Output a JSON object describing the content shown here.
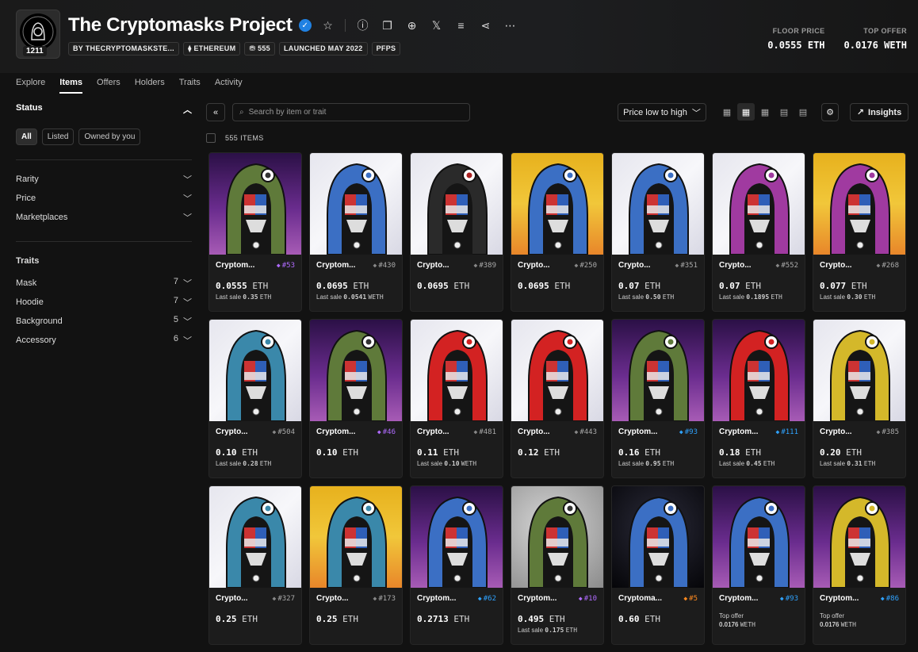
{
  "header": {
    "title": "The Cryptomasks Project",
    "logo_text": "THE CRYPTOMASKS",
    "logo_count": "1211",
    "tags": [
      "BY THECRYPTOMASKSTE...",
      "⧫ ETHEREUM",
      "555",
      "LAUNCHED MAY 2022",
      "PFPS"
    ],
    "stats": [
      {
        "label": "FLOOR PRICE",
        "value": "0.0555 ETH"
      },
      {
        "label": "TOP OFFER",
        "value": "0.0176 WETH"
      }
    ]
  },
  "nav": [
    "Explore",
    "Items",
    "Offers",
    "Holders",
    "Traits",
    "Activity"
  ],
  "sidebar": {
    "status_label": "Status",
    "chips": [
      "All",
      "Listed",
      "Owned by you"
    ],
    "filters": [
      "Rarity",
      "Price",
      "Marketplaces"
    ],
    "traits_label": "Traits",
    "traits": [
      {
        "name": "Mask",
        "count": "7"
      },
      {
        "name": "Hoodie",
        "count": "7"
      },
      {
        "name": "Background",
        "count": "5"
      },
      {
        "name": "Accessory",
        "count": "6"
      }
    ]
  },
  "toolbar": {
    "search_placeholder": "Search by item or trait",
    "sort": "Price low to high",
    "insights": "Insights"
  },
  "items_count": "555 ITEMS",
  "items": [
    {
      "name": "Cryptom...",
      "rank": "#53",
      "gem": "#b06bff",
      "price": "0.0555",
      "unit": "ETH",
      "sub_label": "Last sale",
      "sub_val": "0.35",
      "sub_unit": "ETH",
      "bg": "purple",
      "hood": "#5f7a3a",
      "crest": "#333"
    },
    {
      "name": "Cryptom...",
      "rank": "#430",
      "gem": "#888",
      "price": "0.0695",
      "unit": "ETH",
      "sub_label": "Last sale",
      "sub_val": "0.0541",
      "sub_unit": "WETH",
      "bg": "white",
      "hood": "#3b6fc4",
      "crest": "#3b6fc4"
    },
    {
      "name": "Crypto...",
      "rank": "#389",
      "gem": "#888",
      "price": "0.0695",
      "unit": "ETH",
      "sub_label": "",
      "sub_val": "",
      "sub_unit": "",
      "bg": "white",
      "hood": "#2a2a2a",
      "crest": "#aa2222"
    },
    {
      "name": "Crypto...",
      "rank": "#250",
      "gem": "#888",
      "price": "0.0695",
      "unit": "ETH",
      "sub_label": "",
      "sub_val": "",
      "sub_unit": "",
      "bg": "yellow",
      "hood": "#3b6fc4",
      "crest": "#3b6fc4"
    },
    {
      "name": "Crypto...",
      "rank": "#351",
      "gem": "#888",
      "price": "0.07",
      "unit": "ETH",
      "sub_label": "Last sale",
      "sub_val": "0.50",
      "sub_unit": "ETH",
      "bg": "white",
      "hood": "#3b6fc4",
      "crest": "#3b6fc4"
    },
    {
      "name": "Crypto...",
      "rank": "#552",
      "gem": "#888",
      "price": "0.07",
      "unit": "ETH",
      "sub_label": "Last sale",
      "sub_val": "0.1895",
      "sub_unit": "ETH",
      "bg": "white",
      "hood": "#a03aa0",
      "crest": "#a03aa0"
    },
    {
      "name": "Crypto...",
      "rank": "#268",
      "gem": "#888",
      "price": "0.077",
      "unit": "ETH",
      "sub_label": "Last sale",
      "sub_val": "0.30",
      "sub_unit": "ETH",
      "bg": "yellow",
      "hood": "#a03aa0",
      "crest": "#a03aa0"
    },
    {
      "name": "Crypto...",
      "rank": "#504",
      "gem": "#888",
      "price": "0.10",
      "unit": "ETH",
      "sub_label": "Last sale",
      "sub_val": "0.28",
      "sub_unit": "ETH",
      "bg": "white",
      "hood": "#3a88aa",
      "crest": "#3a88aa"
    },
    {
      "name": "Cryptom...",
      "rank": "#46",
      "gem": "#b06bff",
      "price": "0.10",
      "unit": "ETH",
      "sub_label": "",
      "sub_val": "",
      "sub_unit": "",
      "bg": "purple",
      "hood": "#5f7a3a",
      "crest": "#333"
    },
    {
      "name": "Crypto...",
      "rank": "#481",
      "gem": "#888",
      "price": "0.11",
      "unit": "ETH",
      "sub_label": "Last sale",
      "sub_val": "0.10",
      "sub_unit": "WETH",
      "bg": "white",
      "hood": "#d32222",
      "crest": "#d32222"
    },
    {
      "name": "Crypto...",
      "rank": "#443",
      "gem": "#888",
      "price": "0.12",
      "unit": "ETH",
      "sub_label": "",
      "sub_val": "",
      "sub_unit": "",
      "bg": "white",
      "hood": "#d32222",
      "crest": "#d32222"
    },
    {
      "name": "Cryptom...",
      "rank": "#93",
      "gem": "#2fa3ff",
      "price": "0.16",
      "unit": "ETH",
      "sub_label": "Last sale",
      "sub_val": "0.95",
      "sub_unit": "ETH",
      "bg": "purple",
      "hood": "#5f7a3a",
      "crest": "#5f7a3a"
    },
    {
      "name": "Cryptom...",
      "rank": "#111",
      "gem": "#2fa3ff",
      "price": "0.18",
      "unit": "ETH",
      "sub_label": "Last sale",
      "sub_val": "0.45",
      "sub_unit": "ETH",
      "bg": "purple",
      "hood": "#d32222",
      "crest": "#d32222"
    },
    {
      "name": "Crypto...",
      "rank": "#385",
      "gem": "#888",
      "price": "0.20",
      "unit": "ETH",
      "sub_label": "Last sale",
      "sub_val": "0.31",
      "sub_unit": "ETH",
      "bg": "white",
      "hood": "#d4b82a",
      "crest": "#d4b82a"
    },
    {
      "name": "Crypto...",
      "rank": "#327",
      "gem": "#888",
      "price": "0.25",
      "unit": "ETH",
      "sub_label": "",
      "sub_val": "",
      "sub_unit": "",
      "bg": "white",
      "hood": "#3a88aa",
      "crest": "#3a88aa"
    },
    {
      "name": "Crypto...",
      "rank": "#173",
      "gem": "#888",
      "price": "0.25",
      "unit": "ETH",
      "sub_label": "",
      "sub_val": "",
      "sub_unit": "",
      "bg": "yellow",
      "hood": "#3a88aa",
      "crest": "#3a88aa"
    },
    {
      "name": "Cryptom...",
      "rank": "#62",
      "gem": "#2fa3ff",
      "price": "0.2713",
      "unit": "ETH",
      "sub_label": "",
      "sub_val": "",
      "sub_unit": "",
      "bg": "purple",
      "hood": "#3b6fc4",
      "crest": "#3b6fc4"
    },
    {
      "name": "Cryptom...",
      "rank": "#10",
      "gem": "#b06bff",
      "price": "0.495",
      "unit": "ETH",
      "sub_label": "Last sale",
      "sub_val": "0.175",
      "sub_unit": "ETH",
      "bg": "grey",
      "hood": "#5f7a3a",
      "crest": "#333"
    },
    {
      "name": "Cryptoma...",
      "rank": "#5",
      "gem": "#ff8a1f",
      "price": "0.60",
      "unit": "ETH",
      "sub_label": "",
      "sub_val": "",
      "sub_unit": "",
      "bg": "space",
      "hood": "#3b6fc4",
      "crest": "#3b6fc4"
    },
    {
      "name": "Cryptom...",
      "rank": "#93",
      "gem": "#2fa3ff",
      "price": "",
      "unit": "",
      "sub_label": "Top offer",
      "sub_val": "0.0176",
      "sub_unit": "WETH",
      "bg": "purple",
      "hood": "#3b6fc4",
      "crest": "#3b6fc4"
    },
    {
      "name": "Cryptom...",
      "rank": "#86",
      "gem": "#2fa3ff",
      "price": "",
      "unit": "",
      "sub_label": "Top offer",
      "sub_val": "0.0176",
      "sub_unit": "WETH",
      "bg": "purple",
      "hood": "#d4b82a",
      "crest": "#d4b82a"
    }
  ]
}
